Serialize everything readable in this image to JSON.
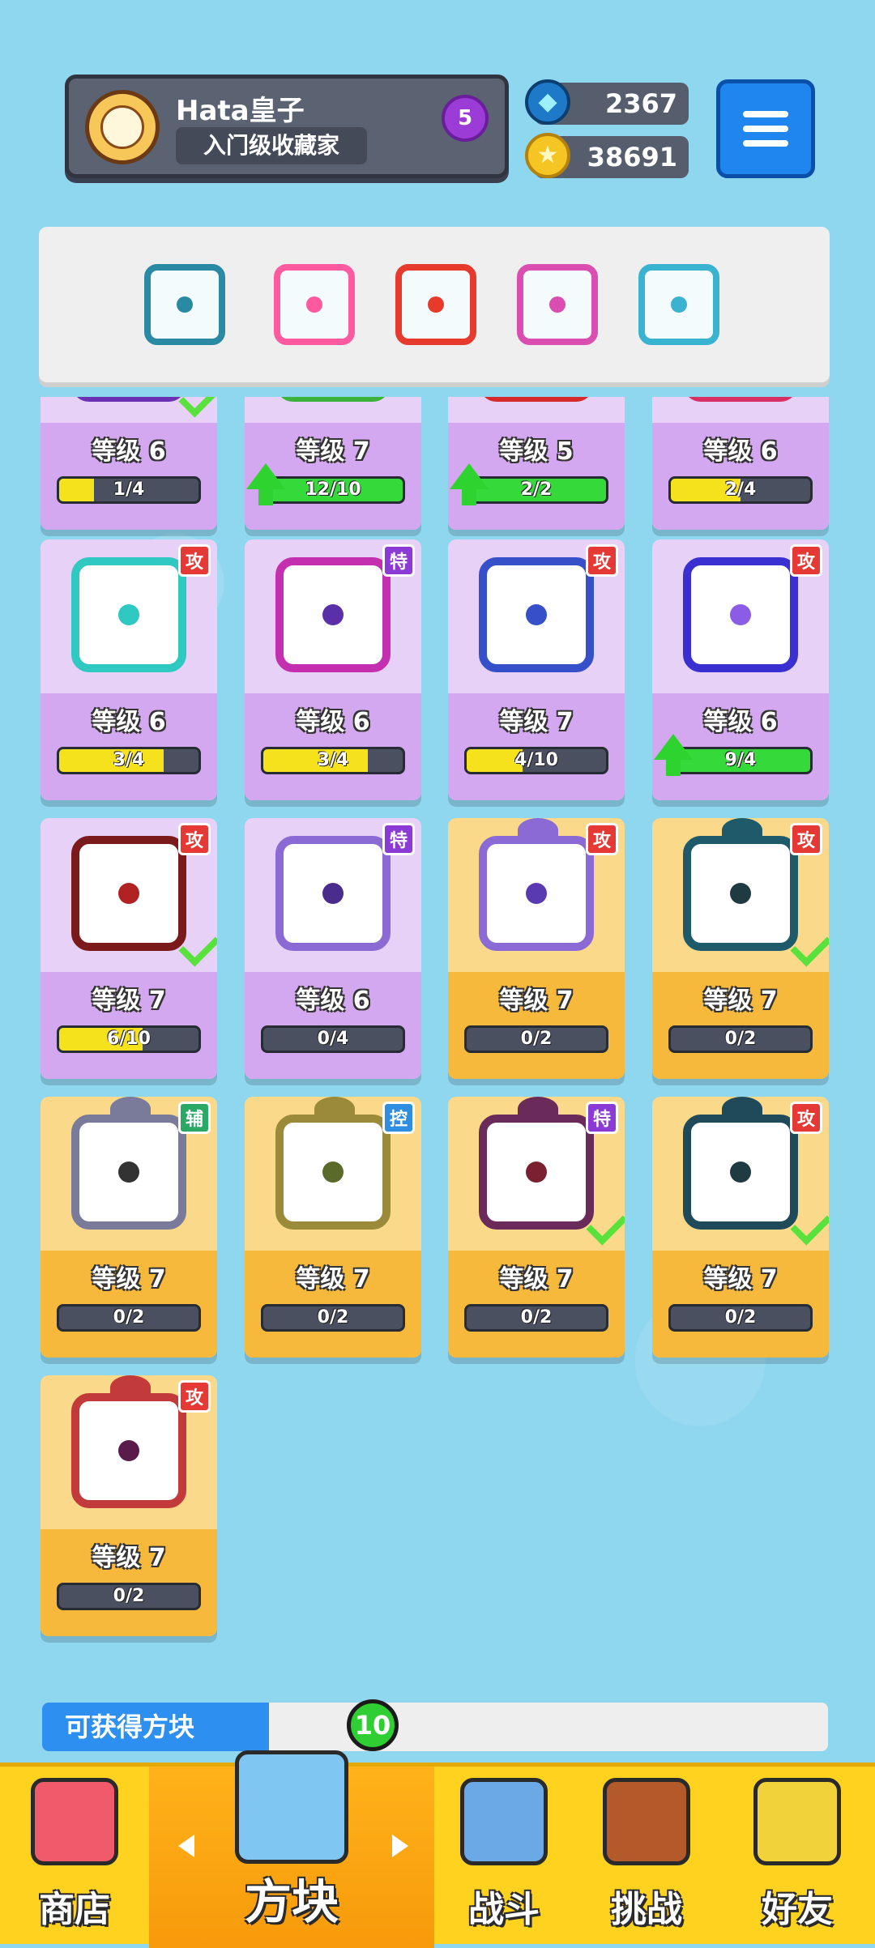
{
  "profile": {
    "name": "Hata皇子",
    "title": "入门级收藏家",
    "rank": "5"
  },
  "currency": {
    "gems": "2367",
    "coins": "38691"
  },
  "icons": {
    "menu": "hamburger-menu-icon",
    "gem": "gem-icon",
    "coin": "star-coin-icon"
  },
  "deck": [
    {
      "name": "vortex-dragon-dice",
      "color": "#2a8aa3"
    },
    {
      "name": "rainbow-dice",
      "color": "#ff5aa0"
    },
    {
      "name": "fire-dice",
      "color": "#e53a2c"
    },
    {
      "name": "pink-dragon-dice",
      "color": "#d94eb0"
    },
    {
      "name": "ice-dragon-dice",
      "color": "#39b3cf"
    }
  ],
  "cards": [
    {
      "level": "等级 6",
      "progress": "1/4",
      "ratio": 0.25,
      "tier": "purple",
      "border": "#6a2fb3",
      "pip": "#6a2fb3",
      "tag": "",
      "check": true,
      "up": false
    },
    {
      "level": "等级 7",
      "progress": "12/10",
      "ratio": 1.0,
      "tier": "purple",
      "border": "#3bb33b",
      "pip": "#3bb33b",
      "tag": "",
      "check": false,
      "up": true
    },
    {
      "level": "等级 5",
      "progress": "2/2",
      "ratio": 1.0,
      "tier": "purple",
      "border": "#d62a2a",
      "pip": "#d62a2a",
      "tag": "",
      "check": false,
      "up": true
    },
    {
      "level": "等级 6",
      "progress": "2/4",
      "ratio": 0.5,
      "tier": "purple",
      "border": "#d92f64",
      "pip": "#d92f64",
      "tag": "",
      "check": false,
      "up": false
    },
    {
      "level": "等级 6",
      "progress": "3/4",
      "ratio": 0.75,
      "tier": "purple",
      "border": "#2fc9c2",
      "pip": "#2fc9c2",
      "tag": "攻",
      "tagColor": "#e53935",
      "check": false,
      "up": false
    },
    {
      "level": "等级 6",
      "progress": "3/4",
      "ratio": 0.75,
      "tier": "purple",
      "border": "#c32fae",
      "pip": "#5a2fa8",
      "tag": "特",
      "tagColor": "#8c3ad6",
      "check": false,
      "up": false
    },
    {
      "level": "等级 7",
      "progress": "4/10",
      "ratio": 0.4,
      "tier": "purple",
      "border": "#3550c9",
      "pip": "#3550c9",
      "tag": "攻",
      "tagColor": "#e53935",
      "check": false,
      "up": false
    },
    {
      "level": "等级 6",
      "progress": "9/4",
      "ratio": 1.0,
      "tier": "purple",
      "border": "#3a2fd0",
      "pip": "#8b5ce6",
      "tag": "攻",
      "tagColor": "#e53935",
      "check": false,
      "up": true
    },
    {
      "level": "等级 7",
      "progress": "6/10",
      "ratio": 0.6,
      "tier": "purple",
      "border": "#7a1a1a",
      "pip": "#b32222",
      "tag": "攻",
      "tagColor": "#e53935",
      "check": true,
      "up": false
    },
    {
      "level": "等级 6",
      "progress": "0/4",
      "ratio": 0,
      "tier": "purple",
      "border": "#8c6ad6",
      "pip": "#4a2c8c",
      "tag": "特",
      "tagColor": "#8c3ad6",
      "check": false,
      "up": false
    },
    {
      "level": "等级 7",
      "progress": "0/2",
      "ratio": 0,
      "tier": "gold",
      "border": "#8c6ad6",
      "pip": "#5a3ab0",
      "tag": "攻",
      "tagColor": "#e53935",
      "check": false,
      "up": false
    },
    {
      "level": "等级 7",
      "progress": "0/2",
      "ratio": 0,
      "tier": "gold",
      "border": "#1f5a6a",
      "pip": "#1f3a40",
      "tag": "攻",
      "tagColor": "#e53935",
      "check": true,
      "up": false
    },
    {
      "level": "等级 7",
      "progress": "0/2",
      "ratio": 0,
      "tier": "gold",
      "border": "#7a7a9a",
      "pip": "#333333",
      "tag": "辅",
      "tagColor": "#2aa866",
      "check": false,
      "up": false
    },
    {
      "level": "等级 7",
      "progress": "0/2",
      "ratio": 0,
      "tier": "gold",
      "border": "#9a8a3a",
      "pip": "#5a6a2a",
      "tag": "控",
      "tagColor": "#2f8ee0",
      "check": false,
      "up": false
    },
    {
      "level": "等级 7",
      "progress": "0/2",
      "ratio": 0,
      "tier": "gold",
      "border": "#6a2a5a",
      "pip": "#7a2030",
      "tag": "特",
      "tagColor": "#8c3ad6",
      "check": true,
      "up": false
    },
    {
      "level": "等级 7",
      "progress": "0/2",
      "ratio": 0,
      "tier": "gold",
      "border": "#1f4a5a",
      "pip": "#1f3a40",
      "tag": "攻",
      "tagColor": "#e53935",
      "check": true,
      "up": false
    },
    {
      "level": "等级 7",
      "progress": "0/2",
      "ratio": 0,
      "tier": "gold",
      "border": "#c23a3a",
      "pip": "#5a1a4a",
      "tag": "攻",
      "tagColor": "#e53935",
      "check": false,
      "up": false
    }
  ],
  "available": {
    "label": "可获得方块",
    "new_count": "10"
  },
  "nav": [
    {
      "label": "商店",
      "icon": "shop-icon",
      "color": "#f05a6a"
    },
    {
      "label": "方块",
      "icon": "dice-box-icon",
      "color": "#7fc6f2",
      "active": true
    },
    {
      "label": "战斗",
      "icon": "battle-icon",
      "color": "#6aa9e6"
    },
    {
      "label": "挑战",
      "icon": "challenge-icon",
      "color": "#b3592a"
    },
    {
      "label": "好友",
      "icon": "friends-icon",
      "color": "#f2d23a"
    }
  ]
}
